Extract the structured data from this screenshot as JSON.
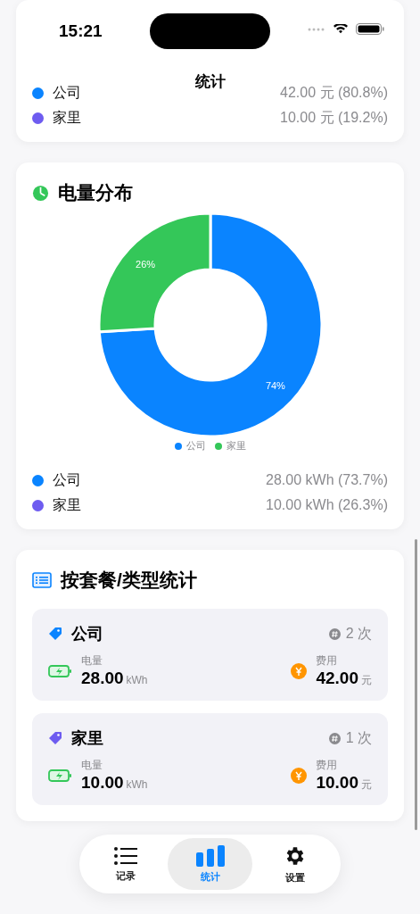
{
  "status_bar": {
    "time": "15:21"
  },
  "nav": {
    "title": "统计"
  },
  "cost_card": {
    "rows": [
      {
        "name": "公司",
        "value": "42.00 元 (80.8%)",
        "color": "#0a84ff"
      },
      {
        "name": "家里",
        "value": "10.00 元 (19.2%)",
        "color": "#6e5cf0"
      }
    ]
  },
  "energy_card": {
    "title": "电量分布",
    "chart_data": {
      "type": "donut",
      "categories": [
        "公司",
        "家里"
      ],
      "values": [
        74,
        26
      ],
      "colors": [
        "#0a84ff",
        "#34c759"
      ],
      "value_labels": [
        "74%",
        "26%"
      ],
      "legend": true
    },
    "rows": [
      {
        "name": "公司",
        "value": "28.00 kWh (73.7%)",
        "color": "#0a84ff"
      },
      {
        "name": "家里",
        "value": "10.00 kWh (26.3%)",
        "color": "#6e5cf0"
      }
    ]
  },
  "type_card": {
    "title": "按套餐/类型统计",
    "items": [
      {
        "name": "公司",
        "color": "#0a84ff",
        "count": "2 次",
        "energy_label": "电量",
        "energy": "28.00",
        "energy_unit": "kWh",
        "cost_label": "费用",
        "cost": "42.00",
        "cost_unit": "元"
      },
      {
        "name": "家里",
        "color": "#6e5cf0",
        "count": "1 次",
        "energy_label": "电量",
        "energy": "10.00",
        "energy_unit": "kWh",
        "cost_label": "费用",
        "cost": "10.00",
        "cost_unit": "元"
      }
    ]
  },
  "tab_bar": {
    "tabs": [
      {
        "label": "记录",
        "kind": "list",
        "selected": false
      },
      {
        "label": "统计",
        "kind": "chart",
        "selected": true
      },
      {
        "label": "设置",
        "kind": "gear",
        "selected": false
      }
    ]
  }
}
